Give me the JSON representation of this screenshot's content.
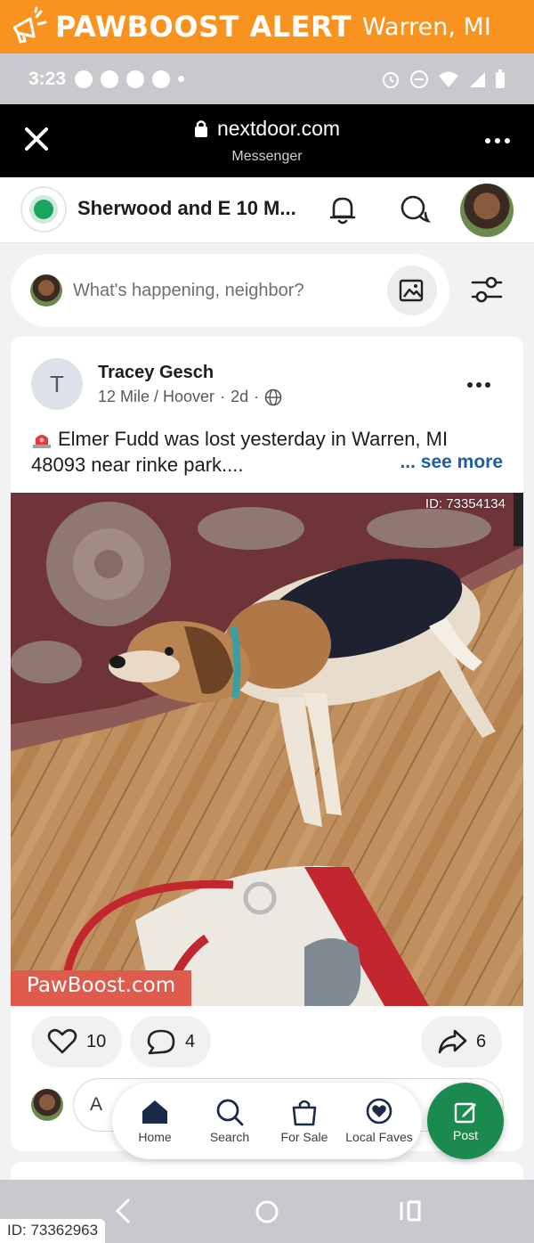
{
  "pawboost": {
    "title": "PAWBOOST ALERT",
    "location": "Warren, MI",
    "bottom_id": "ID: 73362963"
  },
  "status_bar": {
    "time": "3:23"
  },
  "browser": {
    "url": "nextdoor.com",
    "subtitle": "Messenger"
  },
  "header": {
    "neighborhood": "Sherwood and E 10 M..."
  },
  "composer": {
    "placeholder": "What's happening, neighbor?"
  },
  "post": {
    "author_initial": "T",
    "author": "Tracey Gesch",
    "location": "12 Mile / Hoover",
    "age": "2d",
    "text_line1": "Elmer Fudd was lost yesterday in Warren, MI",
    "text_line2": "48093 near rinke park....",
    "see_more": "... see more",
    "photo_id": "ID: 73354134",
    "photo_watermark": "PawBoost.com",
    "likes": "10",
    "comments": "4",
    "shares": "6",
    "comment_placeholder": "A"
  },
  "nav": {
    "home": "Home",
    "search": "Search",
    "for_sale": "For Sale",
    "local_faves": "Local Faves",
    "post": "Post"
  },
  "colors": {
    "pawboost_orange": "#f7931e",
    "nextdoor_green": "#1a8a4f",
    "link_blue": "#1d5fa1"
  }
}
